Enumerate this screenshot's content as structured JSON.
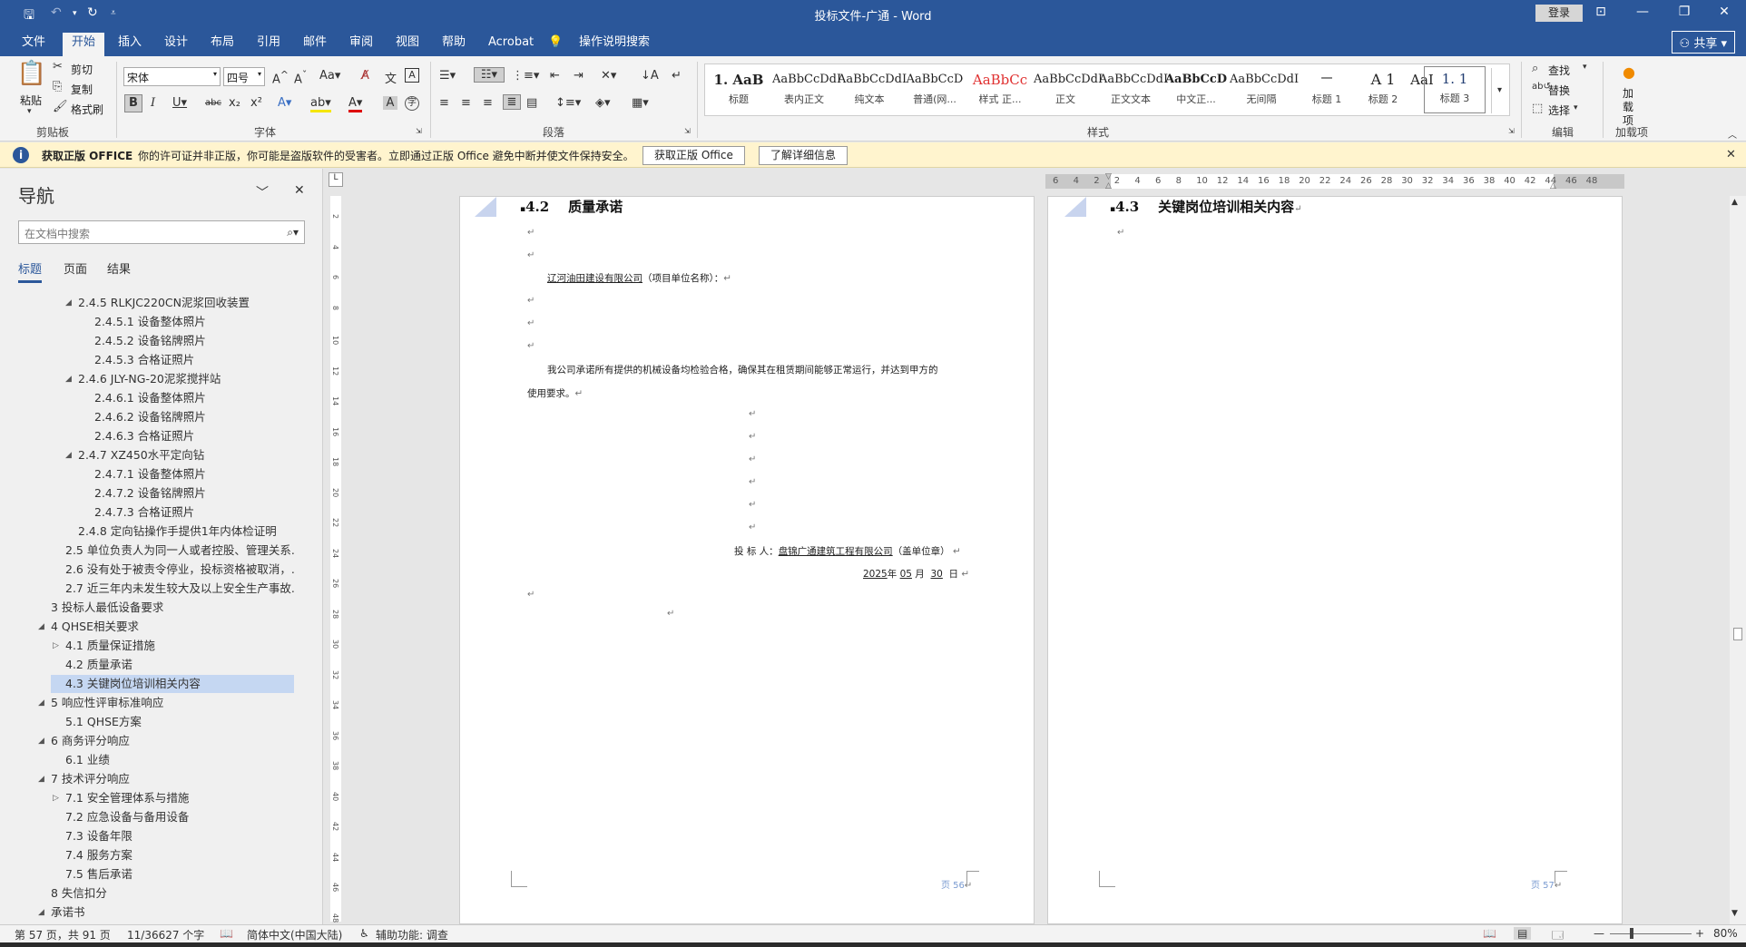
{
  "app": {
    "title": "投标文件-广通 - Word",
    "login": "登录",
    "share": "共享"
  },
  "ribbon_tabs": [
    "文件",
    "开始",
    "插入",
    "设计",
    "布局",
    "引用",
    "邮件",
    "审阅",
    "视图",
    "帮助",
    "Acrobat",
    "操作说明搜索"
  ],
  "ribbon": {
    "clipboard": {
      "paste": "粘贴",
      "cut": "剪切",
      "copy": "复制",
      "format_painter": "格式刷",
      "label": "剪贴板"
    },
    "font": {
      "name": "宋体",
      "size": "四号",
      "label": "字体"
    },
    "paragraph": {
      "label": "段落"
    },
    "styles": {
      "label": "样式",
      "items": [
        {
          "preview": "1. AaB",
          "name": "标题"
        },
        {
          "preview": "AaBbCcDdI",
          "name": "表内正文"
        },
        {
          "preview": "AaBbCcDdI",
          "name": "纯文本"
        },
        {
          "preview": "AaBbCcD",
          "name": "普通(网..."
        },
        {
          "preview": "AaBbCc",
          "name": "样式 正..."
        },
        {
          "preview": "AaBbCcDdI",
          "name": "正文"
        },
        {
          "preview": "AaBbCcDdI",
          "name": "正文文本"
        },
        {
          "preview": "AaBbCcD",
          "name": "中文正..."
        },
        {
          "preview": "AaBbCcDdI",
          "name": "无间隔"
        },
        {
          "preview": "一",
          "name": "标题 1"
        },
        {
          "preview": "A 1",
          "name": "标题 2"
        },
        {
          "preview": "AaI",
          "name": "标题 3"
        },
        {
          "preview": "1. 1",
          "name": "标题 3"
        }
      ]
    },
    "editing": {
      "find": "查找",
      "replace": "替换",
      "select": "选择",
      "label": "编辑"
    },
    "addins": {
      "button": "加载项",
      "label": "加载项"
    }
  },
  "infobar": {
    "title": "获取正版 OFFICE",
    "message": "你的许可证并非正版，你可能是盗版软件的受害者。立即通过正版 Office 避免中断并使文件保持安全。",
    "button1": "获取正版 Office",
    "button2": "了解详细信息"
  },
  "nav": {
    "title": "导航",
    "search_placeholder": "在文档中搜索",
    "tabs": [
      "标题",
      "页面",
      "结果"
    ],
    "items": [
      {
        "text": "2.4.5 RLKJC220CN泥浆回收装置",
        "level": 2,
        "tw": "◢"
      },
      {
        "text": "2.4.5.1 设备整体照片",
        "level": 3
      },
      {
        "text": "2.4.5.2 设备铭牌照片",
        "level": 3
      },
      {
        "text": "2.4.5.3 合格证照片",
        "level": 3
      },
      {
        "text": "2.4.6 JLY-NG-20泥浆搅拌站",
        "level": 2,
        "tw": "◢"
      },
      {
        "text": "2.4.6.1 设备整体照片",
        "level": 3
      },
      {
        "text": "2.4.6.2 设备铭牌照片",
        "level": 3
      },
      {
        "text": "2.4.6.3 合格证照片",
        "level": 3
      },
      {
        "text": "2.4.7 XZ450水平定向钻",
        "level": 2,
        "tw": "◢"
      },
      {
        "text": "2.4.7.1 设备整体照片",
        "level": 3
      },
      {
        "text": "2.4.7.2 设备铭牌照片",
        "level": 3
      },
      {
        "text": "2.4.7.3 合格证照片",
        "level": 3
      },
      {
        "text": "2.4.8 定向钻操作手提供1年内体检证明",
        "level": 2
      },
      {
        "text": "2.5 单位负责人为同一人或者控股、管理关系...",
        "level": 1
      },
      {
        "text": "2.6 没有处于被责令停业，投标资格被取消，...",
        "level": 1
      },
      {
        "text": "2.7 近三年内未发生较大及以上安全生产事故...",
        "level": 1
      },
      {
        "text": "3 投标人最低设备要求",
        "level": 0
      },
      {
        "text": "4 QHSE相关要求",
        "level": 0,
        "tw": "◢"
      },
      {
        "text": "4.1 质量保证措施",
        "level": 1,
        "tw": "▷"
      },
      {
        "text": "4.2 质量承诺",
        "level": 1
      },
      {
        "text": "4.3 关键岗位培训相关内容",
        "level": 1,
        "selected": true
      },
      {
        "text": "5 响应性评审标准响应",
        "level": 0,
        "tw": "◢"
      },
      {
        "text": "5.1 QHSE方案",
        "level": 1
      },
      {
        "text": "6 商务评分响应",
        "level": 0,
        "tw": "◢"
      },
      {
        "text": "6.1 业绩",
        "level": 1
      },
      {
        "text": "7 技术评分响应",
        "level": 0,
        "tw": "◢"
      },
      {
        "text": "7.1 安全管理体系与措施",
        "level": 1,
        "tw": "▷"
      },
      {
        "text": "7.2 应急设备与备用设备",
        "level": 1
      },
      {
        "text": "7.3 设备年限",
        "level": 1
      },
      {
        "text": "7.4 服务方案",
        "level": 1
      },
      {
        "text": "7.5 售后承诺",
        "level": 1
      },
      {
        "text": "8 失信扣分",
        "level": 0
      },
      {
        "text": "承诺书",
        "level": 0,
        "tw": "◢"
      }
    ]
  },
  "ruler": {
    "h_ticks": [
      "6",
      "4",
      "2",
      "2",
      "4",
      "6",
      "8",
      "10",
      "12",
      "14",
      "16",
      "18",
      "20",
      "22",
      "24",
      "26",
      "28",
      "30",
      "32",
      "34",
      "36",
      "38",
      "40",
      "42",
      "44",
      "46",
      "48"
    ],
    "v_ticks": [
      "2",
      "4",
      "6",
      "8",
      "10",
      "12",
      "14",
      "16",
      "18",
      "20",
      "22",
      "24",
      "26",
      "28",
      "30",
      "32",
      "34",
      "36",
      "38",
      "40",
      "42",
      "44",
      "46",
      "48"
    ]
  },
  "page56": {
    "heading_num": "4.2",
    "heading_text": "质量承诺",
    "recipient": "辽河油田建设有限公司",
    "recipient_suffix": "（项目单位名称）：",
    "body1": "我公司承诺所有提供的机械设备均检验合格，确保其在租赁期间能够正常运行，并达到甲方的",
    "body2": "使用要求。",
    "bidder_label": "投 标 人：",
    "bidder_name": "盘锦广通建筑工程有限公司",
    "bidder_suffix": "（盖单位章）",
    "date_year": "2025",
    "date_y": "年",
    "date_month": "05",
    "date_m": "月",
    "date_day": "30",
    "date_d": "日",
    "page_label": "页 56"
  },
  "page57": {
    "heading_num": "4.3",
    "heading_text": "关键岗位培训相关内容",
    "page_label": "页 57"
  },
  "status": {
    "page": "第 57 页，共 91 页",
    "words": "11/36627 个字",
    "language": "简体中文(中国大陆)",
    "accessibility": "辅助功能: 调查",
    "zoom": "80%"
  }
}
